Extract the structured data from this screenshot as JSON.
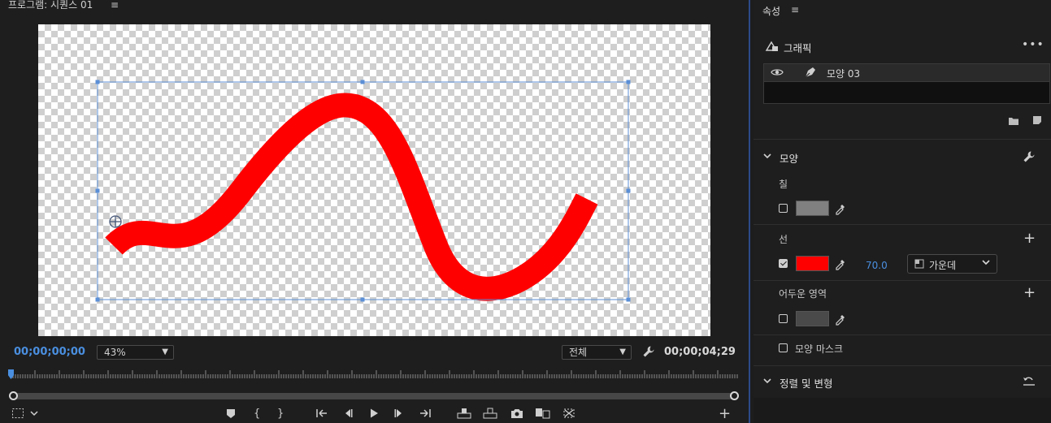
{
  "monitor": {
    "title": "프로그램: 시퀀스 01",
    "menu_glyph": "≡",
    "timecode_current": "00;00;00;00",
    "timecode_duration": "00;00;04;29",
    "zoom": "43%",
    "fit": "전체",
    "transport_buttons": [
      "marker-icon",
      "mark-in-icon",
      "mark-out-icon",
      "go-to-in-icon",
      "step-back-icon",
      "play-icon",
      "step-forward-icon",
      "go-to-out-icon",
      "lift-icon",
      "extract-icon",
      "export-frame-icon",
      "compare-icon",
      "proxy-icon",
      "add-button-icon"
    ]
  },
  "canvas": {
    "stroke_color": "#ff0000",
    "bbox_color": "#5b8fd6"
  },
  "properties": {
    "title": "속성",
    "menu_glyph": "≡",
    "graphic_label": "그래픽",
    "more_glyph": "•••",
    "layer_name": "모양 03",
    "shape_section": "모양",
    "fill_label": "칠",
    "fill_color": "#808080",
    "stroke_label": "선",
    "stroke_color": "#ff0000",
    "stroke_width": "70.0",
    "stroke_align": "가운데",
    "shadow_label": "어두운 영역",
    "shadow_color": "#4a4a4a",
    "shape_mask_label": "모양 마스크",
    "align_transform_section": "정렬 및 변형"
  }
}
